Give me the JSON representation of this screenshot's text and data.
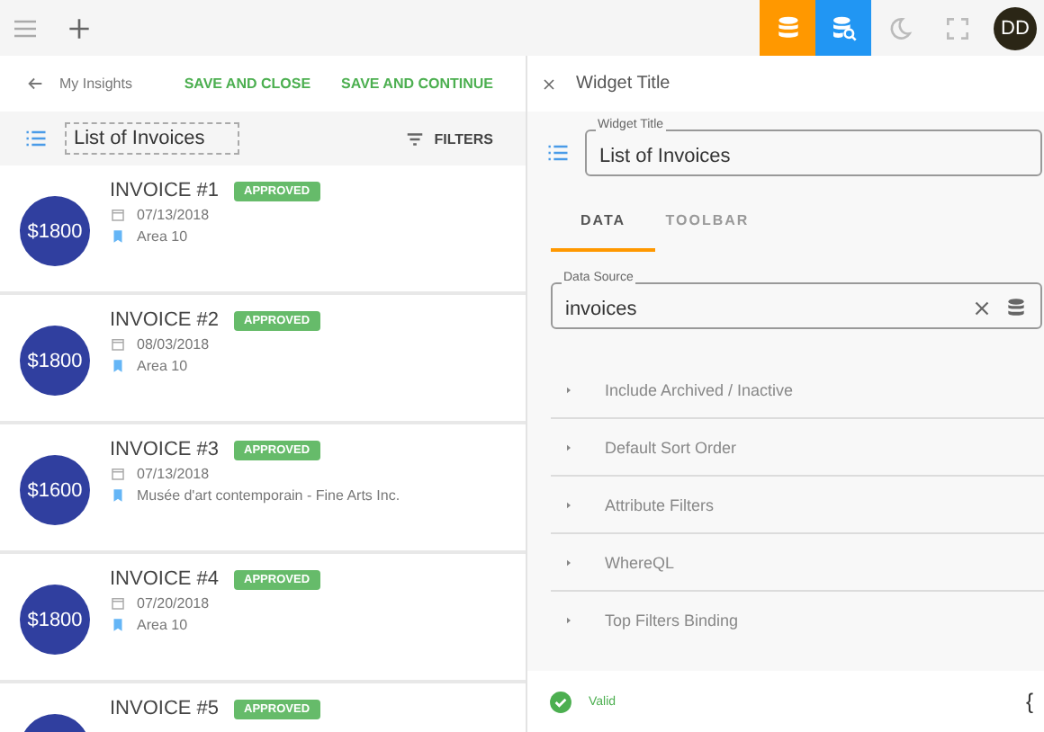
{
  "topbar": {
    "actions": [
      {
        "kind": "database",
        "active": true,
        "color": "#ff9800"
      },
      {
        "kind": "query",
        "active": true,
        "color": "#2196f3"
      },
      {
        "kind": "theme",
        "active": false
      },
      {
        "kind": "fullscreen",
        "active": false
      }
    ],
    "avatar": "DD"
  },
  "left": {
    "back_label": "My Insights",
    "actions": [
      "SAVE AND CLOSE",
      "SAVE AND CONTINUE"
    ],
    "title_value": "List of Invoices",
    "filters": "FILTERS",
    "invoices": [
      {
        "amount": "$1800",
        "title": "INVOICE #1",
        "status": "APPROVED",
        "date": "07/13/2018",
        "location": "Area 10"
      },
      {
        "amount": "$1800",
        "title": "INVOICE #2",
        "status": "APPROVED",
        "date": "08/03/2018",
        "location": "Area 10"
      },
      {
        "amount": "$1600",
        "title": "INVOICE #3",
        "status": "APPROVED",
        "date": "07/13/2018",
        "location": "Musée d'art contemporain - Fine Arts Inc."
      },
      {
        "amount": "$1800",
        "title": "INVOICE #4",
        "status": "APPROVED",
        "date": "07/20/2018",
        "location": "Area 10"
      },
      {
        "title": "INVOICE #5",
        "status": "APPROVED"
      }
    ]
  },
  "right": {
    "title": "Widget Title",
    "title_field": {
      "label": "Widget Title",
      "value": "List of Invoices"
    },
    "tabs": [
      {
        "label": "DATA",
        "selected": true
      },
      {
        "label": "TOOLBAR",
        "selected": false
      }
    ],
    "data_source": {
      "label": "Data Source",
      "value": "invoices"
    },
    "sections": [
      {
        "label": "Include Archived / Inactive",
        "expanded": false
      },
      {
        "label": "Default Sort Order",
        "expanded": false
      },
      {
        "label": "Attribute Filters",
        "expanded": false
      },
      {
        "label": "WhereQL",
        "expanded": false
      },
      {
        "label": "Top Filters Binding",
        "expanded": false
      }
    ],
    "status": {
      "valid": true,
      "label": "Valid"
    },
    "code_toggle": "{"
  }
}
